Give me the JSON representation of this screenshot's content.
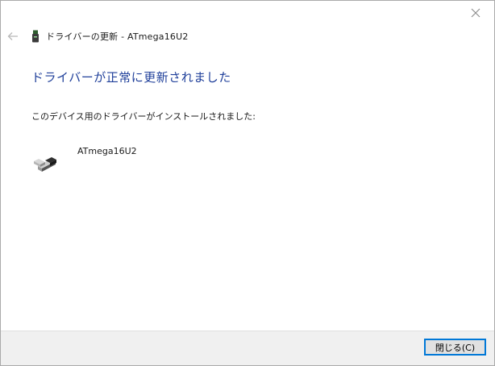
{
  "window": {
    "title": "ドライバーの更新 - ATmega16U2"
  },
  "main": {
    "heading": "ドライバーが正常に更新されました",
    "description": "このデバイス用のドライバーがインストールされました:",
    "device_name": "ATmega16U2"
  },
  "footer": {
    "close_label": "閉じる(C)"
  },
  "icons": {
    "close": "close-icon",
    "back": "back-arrow-icon",
    "title": "device-icon",
    "device": "usb-plug-icon"
  },
  "colors": {
    "heading": "#1f3f9a",
    "button_border": "#0078d7",
    "footer_bg": "#f0f0f0"
  }
}
